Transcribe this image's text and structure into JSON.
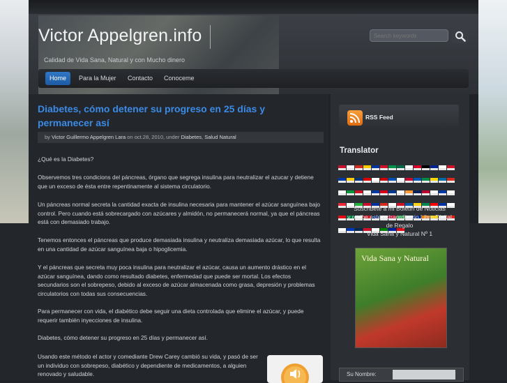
{
  "header": {
    "site_title": "Victor Appelgren.info",
    "tagline": "Calidad de Vida Sana, Natural y con Mucho dinero",
    "search_placeholder": "Search keywords",
    "search_icon": "magnifier-icon"
  },
  "nav": {
    "items": [
      "Home",
      "Para la Mujer",
      "Contacto",
      "Conoceme"
    ],
    "active": "Home"
  },
  "post": {
    "title": "Diabetes, cómo detener su progreso en 25 días y permanecer así",
    "meta": {
      "by": "by",
      "author": "Victor Guillermo Appelgren Lara",
      "on": "on oct.28, 2010, under",
      "cat1": "Diabetes",
      "cat2": "Salud Natural"
    },
    "paragraphs": [
      "¿Qué es la Diabetes?",
      "Observemos tres condicions del páncreas, órgano que segrega insulina para neutralizar el azucar y detiene que un exceso de ésta entre repentinamente al sistema circulatorio.",
      "Un páncreas normal secreta la cantidad exacta de insulina necesaria para mantener el azúcar sanguínea bajo control. Pero cuando está sobrecargado con azúcares y almidón, no permanecerá normal, ya que el páncreas está con demasiado trabajo.",
      "Tenemos entonces el páncreas que produce demasiada insulina y neutraliza demasiada azúcar, lo que resulta en una cantidad de azúcar sanguínea baja o hipoglicemia.",
      "Y el páncreas que secreta muy poca insulina para neutralizar el azúcar, causa un aumento drástico en el azúcar sanguínea, dando como resultado diabetes, enfermedad que puede ser mortal. Los efectos secundarios son el sobrepeso, debido al exceso de azúcar almacenada como grasa, depresión y problemas circulatorios con todas sus consecuencias.",
      "Para permanecer con vida, el diabético debe seguir una dieta controlada que elimine el azúcar, y puede requerir también inyecciones de insulina.",
      "Diabetes, cómo detener su progreso en 25 días y permanecer así.",
      "Usando este método el actor y comediante Drew Carey cambió su vida, y pasó de ser un individuo con sobrepeso, diabético y dependiente de medicamentos, a alguien renovado y saludable."
    ]
  },
  "sidebar": {
    "rss_label": "RSS Feed",
    "translator_heading": "Translator",
    "newsletter_lines": [
      "Suscribete a mi Boletín de Noticias",
      "y recibe este extraordinario Libro Digital",
      "de Regalo",
      "Vida Sana y Natural Nº 1"
    ],
    "book_title": "Vida Sana y Natural",
    "form_label": "Su Nombre:"
  },
  "flag_colors": [
    "#c8102e",
    "#ffffff",
    "#d52b1e",
    "#ffcc00",
    "#0032a0",
    "#ce1126",
    "#009246",
    "#006847",
    "#ffffff",
    "#d80027",
    "#000000",
    "#002395",
    "#ffffff",
    "#ce1126",
    "#0038a8",
    "#ffcd00",
    "#003580",
    "#dd0000",
    "#ffffff",
    "#cc0000",
    "#0052b4",
    "#ffffff",
    "#c60c30",
    "#0057b7",
    "#008c45",
    "#ffd700",
    "#006aa7",
    "#d52b1e",
    "#ffffff",
    "#009639",
    "#ce1126",
    "#ffffff",
    "#0039a6",
    "#d8001a",
    "#003893",
    "#ffffff",
    "#ff9933",
    "#00205b",
    "#bc002d",
    "#ffffff",
    "#0038a8",
    "#ffffff",
    "#ed2939",
    "#ffffff",
    "#1eb53a",
    "#c8102e",
    "#003399",
    "#d52b1e",
    "#ffffff",
    "#ce1126",
    "#0055a4",
    "#fcd116",
    "#008751",
    "#ff0000",
    "#0033a0",
    "#ffffff",
    "#e30a17",
    "#007a3d",
    "#ffffff",
    "#d7141a",
    "#012169",
    "#ffffff",
    "#d00c33",
    "#239f40",
    "#ffffff",
    "#00247d",
    "#f77f00",
    "#ffd100",
    "#ffffff",
    "#da251d",
    "#ffffff",
    "#0038b8",
    "#002654",
    "#ce1126",
    "#ffffff",
    "#008000",
    "#00209f",
    "#e30a17"
  ]
}
